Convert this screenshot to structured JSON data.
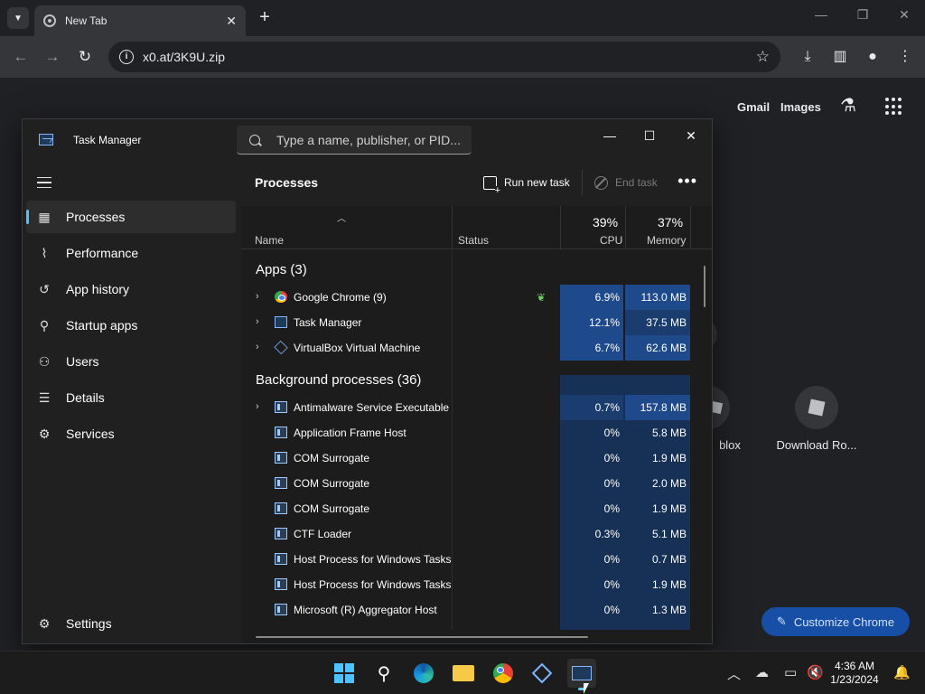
{
  "browser": {
    "tab_title": "New Tab",
    "tab_close": "✕",
    "new_tab": "+",
    "url": "x0.at/3K9U.zip",
    "gmail": "Gmail",
    "images": "Images",
    "shortcuts": [
      "blox",
      "Download Ro..."
    ],
    "customize": "Customize Chrome"
  },
  "task_manager": {
    "title": "Task Manager",
    "search_placeholder": "Type a name, publisher, or PID...",
    "page_title": "Processes",
    "run_new_task": "Run new task",
    "end_task": "End task",
    "nav": [
      {
        "label": "Processes",
        "icon": "processes-icon"
      },
      {
        "label": "Performance",
        "icon": "performance-icon"
      },
      {
        "label": "App history",
        "icon": "history-icon"
      },
      {
        "label": "Startup apps",
        "icon": "startup-icon"
      },
      {
        "label": "Users",
        "icon": "users-icon"
      },
      {
        "label": "Details",
        "icon": "details-icon"
      },
      {
        "label": "Services",
        "icon": "services-icon"
      }
    ],
    "settings": "Settings",
    "columns": {
      "name": "Name",
      "status": "Status",
      "cpu_pct": "39%",
      "cpu": "CPU",
      "mem_pct": "37%",
      "memory": "Memory"
    },
    "groups": {
      "apps": "Apps (3)",
      "background": "Background processes (36)"
    },
    "apps": [
      {
        "name": "Google Chrome (9)",
        "cpu": "6.9%",
        "mem": "113.0 MB",
        "icon": "chrome"
      },
      {
        "name": "Task Manager",
        "cpu": "12.1%",
        "mem": "37.5 MB",
        "icon": "tm"
      },
      {
        "name": "VirtualBox Virtual Machine",
        "cpu": "6.7%",
        "mem": "62.6 MB",
        "icon": "vbox"
      }
    ],
    "background": [
      {
        "name": "Antimalware Service Executable",
        "cpu": "0.7%",
        "mem": "157.8 MB"
      },
      {
        "name": "Application Frame Host",
        "cpu": "0%",
        "mem": "5.8 MB"
      },
      {
        "name": "COM Surrogate",
        "cpu": "0%",
        "mem": "1.9 MB"
      },
      {
        "name": "COM Surrogate",
        "cpu": "0%",
        "mem": "2.0 MB"
      },
      {
        "name": "COM Surrogate",
        "cpu": "0%",
        "mem": "1.9 MB"
      },
      {
        "name": "CTF Loader",
        "cpu": "0.3%",
        "mem": "5.1 MB"
      },
      {
        "name": "Host Process for Windows Tasks",
        "cpu": "0%",
        "mem": "0.7 MB"
      },
      {
        "name": "Host Process for Windows Tasks",
        "cpu": "0%",
        "mem": "1.9 MB"
      },
      {
        "name": "Microsoft (R) Aggregator Host",
        "cpu": "0%",
        "mem": "1.3 MB"
      }
    ]
  },
  "taskbar": {
    "time": "4:36 AM",
    "date": "1/23/2024"
  },
  "colors": {
    "accent": "#4cc2ff",
    "heat_high": "#1e4a8c",
    "heat_mid": "#1a3c6e"
  }
}
